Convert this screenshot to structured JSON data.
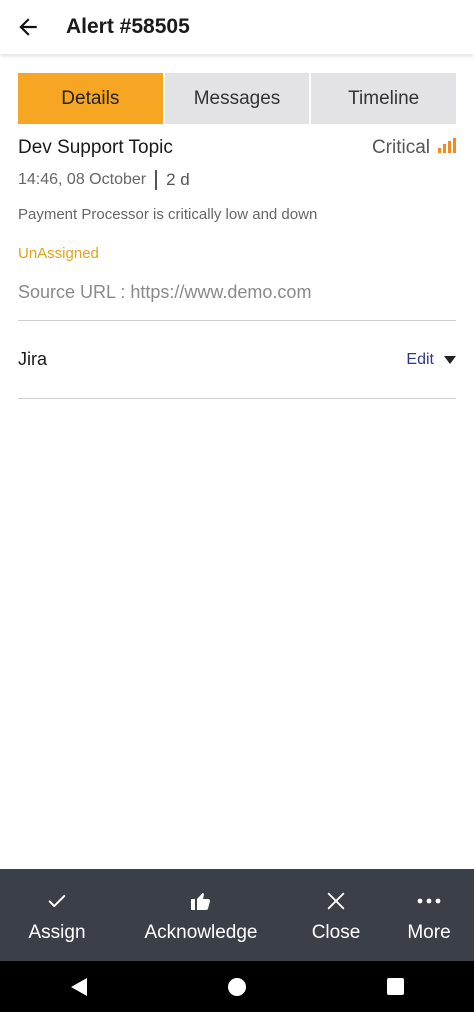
{
  "header": {
    "title": "Alert #58505"
  },
  "tabs": [
    {
      "label": "Details",
      "active": true
    },
    {
      "label": "Messages",
      "active": false
    },
    {
      "label": "Timeline",
      "active": false
    }
  ],
  "alert": {
    "topic": "Dev Support Topic",
    "severity": "Critical",
    "time": "14:46, 08 October",
    "age": "2 d",
    "description": "Payment Processor is critically low and down",
    "assignment": "UnAssigned",
    "source": "Source URL : https://www.demo.com"
  },
  "integration": {
    "label": "Jira",
    "edit_label": "Edit"
  },
  "actions": [
    {
      "label": "Assign",
      "icon": "check-icon"
    },
    {
      "label": "Acknowledge",
      "icon": "thumbs-up-icon"
    },
    {
      "label": "Close",
      "icon": "close-icon"
    },
    {
      "label": "More",
      "icon": "more-icon"
    }
  ],
  "colors": {
    "accent": "#f6a623",
    "assigned": "#e5a316",
    "severity_icon": "#f28a1d",
    "action_bar": "#3a3f48",
    "link": "#2b3a8a"
  }
}
